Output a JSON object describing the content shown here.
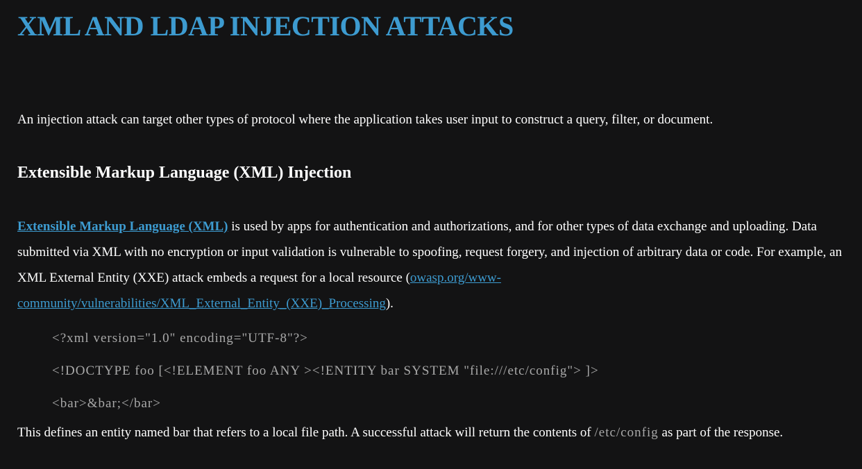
{
  "page": {
    "title": "XML AND LDAP INJECTION ATTACKS",
    "intro": "An injection attack can target other types of protocol where the application takes user input to construct a query, filter, or document.",
    "section_heading": "Extensible Markup Language (XML) Injection",
    "para1": {
      "link_text": "Extensible Markup Language (XML)",
      "text_after_link": " is used by apps for authentication and authorizations, and for other types of data exchange and uploading. Data submitted via XML with no encryption or input validation is vulnerable to spoofing, request forgery, and injection of arbitrary data or code. For example, an XML External Entity (XXE) attack embeds a request for a local resource (",
      "url_link": "owasp.org/www-community/vulnerabilities/XML_External_Entity_(XXE)_Processing",
      "text_end": ")."
    },
    "code_lines": [
      "<?xml version=\"1.0\" encoding=\"UTF-8\"?>",
      "<!DOCTYPE foo [<!ELEMENT foo ANY ><!ENTITY bar SYSTEM \"file:///etc/config\"> ]>",
      "<bar>&bar;</bar>"
    ],
    "para2": {
      "text_before": "This defines an entity named bar that refers to a local file path. A successful attack will return the contents of ",
      "code": "/etc/config",
      "text_after": " as part of the response."
    }
  }
}
